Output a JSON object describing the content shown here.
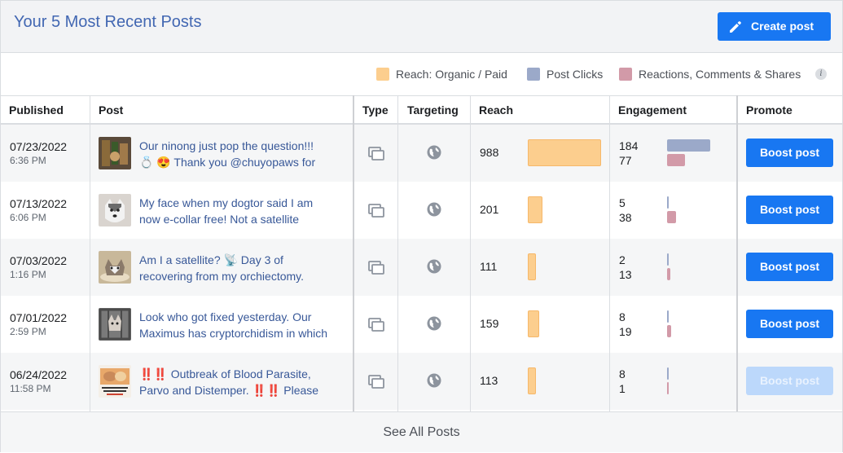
{
  "header": {
    "title": "Your 5 Most Recent Posts",
    "create_post_label": "Create post"
  },
  "legend": [
    {
      "label": "Reach: Organic / Paid",
      "color": "#fcce8e"
    },
    {
      "label": "Post Clicks",
      "color": "#9ba9c9"
    },
    {
      "label": "Reactions, Comments & Shares",
      "color": "#d29aa8"
    }
  ],
  "columns": [
    "Published",
    "Post",
    "Type",
    "Targeting",
    "Reach",
    "Engagement",
    "Promote"
  ],
  "posts": [
    {
      "date": "07/23/2022",
      "time": "6:36 PM",
      "text_line1": "Our ninong just pop the question!!!",
      "text_line2": "💍 😍 Thank you @chuyopaws for",
      "reach": 988,
      "clicks": 184,
      "reactions": 77,
      "boost_label": "Boost post",
      "boost_enabled": true
    },
    {
      "date": "07/13/2022",
      "time": "6:06 PM",
      "text_line1": "My face when my dogtor said I am",
      "text_line2": "now e-collar free! Not a satellite",
      "reach": 201,
      "clicks": 5,
      "reactions": 38,
      "boost_label": "Boost post",
      "boost_enabled": true
    },
    {
      "date": "07/03/2022",
      "time": "1:16 PM",
      "text_line1": "Am I a satellite? 📡 Day 3 of",
      "text_line2": "recovering from my orchiectomy.",
      "reach": 111,
      "clicks": 2,
      "reactions": 13,
      "boost_label": "Boost post",
      "boost_enabled": true
    },
    {
      "date": "07/01/2022",
      "time": "2:59 PM",
      "text_line1": "Look who got fixed yesterday. Our",
      "text_line2": "Maximus has cryptorchidism in which",
      "reach": 159,
      "clicks": 8,
      "reactions": 19,
      "boost_label": "Boost post",
      "boost_enabled": true
    },
    {
      "date": "06/24/2022",
      "time": "11:58 PM",
      "text_line1": "‼️‼️ Outbreak of Blood Parasite,",
      "text_line2": "Parvo and Distemper. ‼️‼️ Please",
      "reach": 113,
      "clicks": 8,
      "reactions": 1,
      "boost_label": "Boost post",
      "boost_enabled": false
    }
  ],
  "footer": {
    "see_all_label": "See All Posts"
  }
}
